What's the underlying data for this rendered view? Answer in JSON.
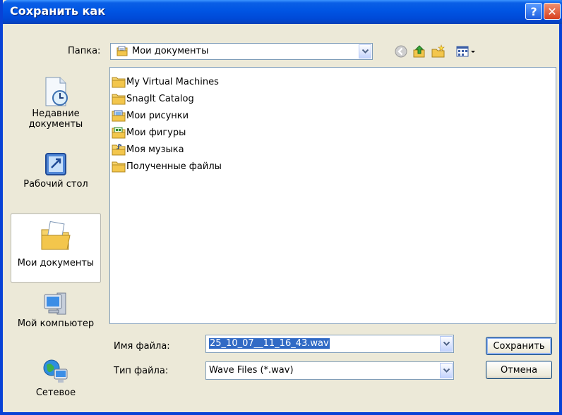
{
  "window": {
    "title": "Сохранить как"
  },
  "titlebar_buttons": {
    "help": "?",
    "close": "✕"
  },
  "toolbar": {
    "look_in_label": "Папка:",
    "look_in_value": "Мои документы",
    "icons": [
      "back-icon",
      "up-folder-icon",
      "new-folder-icon",
      "view-menu-icon"
    ]
  },
  "places": [
    {
      "label": "Недавние документы",
      "icon": "recent-documents-icon",
      "selected": false
    },
    {
      "label": "Рабочий стол",
      "icon": "desktop-icon",
      "selected": false
    },
    {
      "label": "Мои документы",
      "icon": "my-documents-icon",
      "selected": true
    },
    {
      "label": "Мой компьютер",
      "icon": "my-computer-icon",
      "selected": false
    },
    {
      "label": "Сетевое",
      "icon": "network-icon",
      "selected": false
    }
  ],
  "files": [
    {
      "name": "My Virtual Machines",
      "icon": "folder-icon"
    },
    {
      "name": "SnagIt Catalog",
      "icon": "folder-icon"
    },
    {
      "name": "Мои рисунки",
      "icon": "pictures-folder-icon"
    },
    {
      "name": "Мои фигуры",
      "icon": "shapes-folder-icon"
    },
    {
      "name": "Моя музыка",
      "icon": "music-folder-icon"
    },
    {
      "name": "Полученные файлы",
      "icon": "folder-icon"
    }
  ],
  "filename": {
    "label": "Имя файла:",
    "value": "25_10_07__11_16_43.wav"
  },
  "filetype": {
    "label": "Тип файла:",
    "value": "Wave Files (*.wav)"
  },
  "buttons": {
    "save": "Сохранить",
    "cancel": "Отмена"
  },
  "colors": {
    "titlebar": "#0054e3",
    "selection": "#316ac5",
    "dialog_bg": "#ece9d8"
  }
}
